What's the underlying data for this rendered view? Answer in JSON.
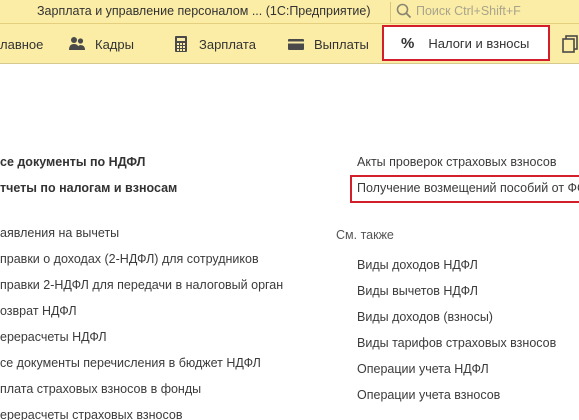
{
  "window": {
    "title": "Зарплата и управление персоналом ...  (1С:Предприятие)",
    "search_placeholder": "Поиск Ctrl+Shift+F"
  },
  "sections": [
    {
      "label": "лавное",
      "icon": "home-icon"
    },
    {
      "label": "Кадры",
      "icon": "people-icon"
    },
    {
      "label": "Зарплата",
      "icon": "calculator-icon"
    },
    {
      "label": "Выплаты",
      "icon": "wallet-icon"
    },
    {
      "label": "Налоги и взносы",
      "icon": "percent-icon",
      "active": true
    },
    {
      "label": "",
      "icon": "documents-icon"
    }
  ],
  "left_column": {
    "bold_items": [
      "се документы по НДФЛ",
      "тчеты по налогам и взносам"
    ],
    "items": [
      "аявления на вычеты",
      "правки о доходах (2-НДФЛ) для сотрудников",
      "правки 2-НДФЛ для передачи в налоговый орган",
      "озврат НДФЛ",
      "ерерасчеты НДФЛ",
      "се документы перечисления в бюджет НДФЛ",
      "плата страховых взносов в фонды",
      "ерерасчеты страховых взносов"
    ]
  },
  "right_column": {
    "items": [
      "Акты проверок страховых взносов",
      "Получение возмещений пособий от ФСС"
    ],
    "see_also_title": "См. также",
    "see_also": [
      "Виды доходов НДФЛ",
      "Виды вычетов НДФЛ",
      "Виды доходов (взносы)",
      "Виды тарифов страховых взносов",
      "Операции учета НДФЛ",
      "Операции учета взносов"
    ]
  },
  "colors": {
    "toolbar_bg": "#fbeda6",
    "highlight_border": "#d21f2b",
    "text": "#333333"
  }
}
